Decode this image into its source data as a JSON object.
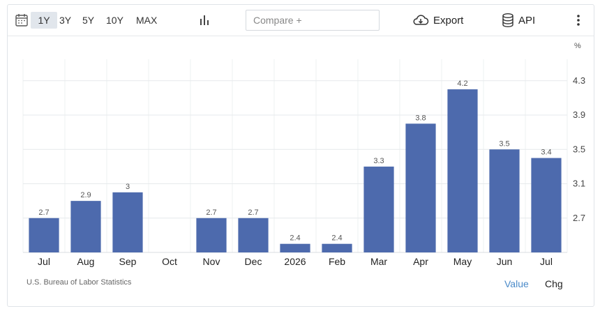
{
  "toolbar": {
    "ranges": [
      "1Y",
      "3Y",
      "5Y",
      "10Y",
      "MAX"
    ],
    "active_range": "1Y",
    "compare_placeholder": "Compare +",
    "export_label": "Export",
    "api_label": "API"
  },
  "footer": {
    "source": "U.S. Bureau of Labor Statistics",
    "value_label": "Value",
    "chg_label": "Chg"
  },
  "chart_data": {
    "type": "bar",
    "unit": "%",
    "categories": [
      "Jul",
      "Aug",
      "Sep",
      "Oct",
      "Nov",
      "Dec",
      "2026",
      "Feb",
      "Mar",
      "Apr",
      "May",
      "Jun",
      "Jul"
    ],
    "values": [
      2.7,
      2.9,
      3,
      null,
      2.7,
      2.7,
      2.4,
      2.4,
      3.3,
      3.8,
      4.2,
      3.5,
      3.4
    ],
    "value_labels": [
      "2.7",
      "2.9",
      "3",
      "",
      "2.7",
      "2.7",
      "2.4",
      "2.4",
      "3.3",
      "3.8",
      "4.2",
      "3.5",
      "3.4"
    ],
    "yticks": [
      2.7,
      3.1,
      3.5,
      3.9,
      4.3
    ],
    "ylim": [
      2.3,
      4.55
    ],
    "bar_color": "#4d6aad",
    "grid": true
  }
}
